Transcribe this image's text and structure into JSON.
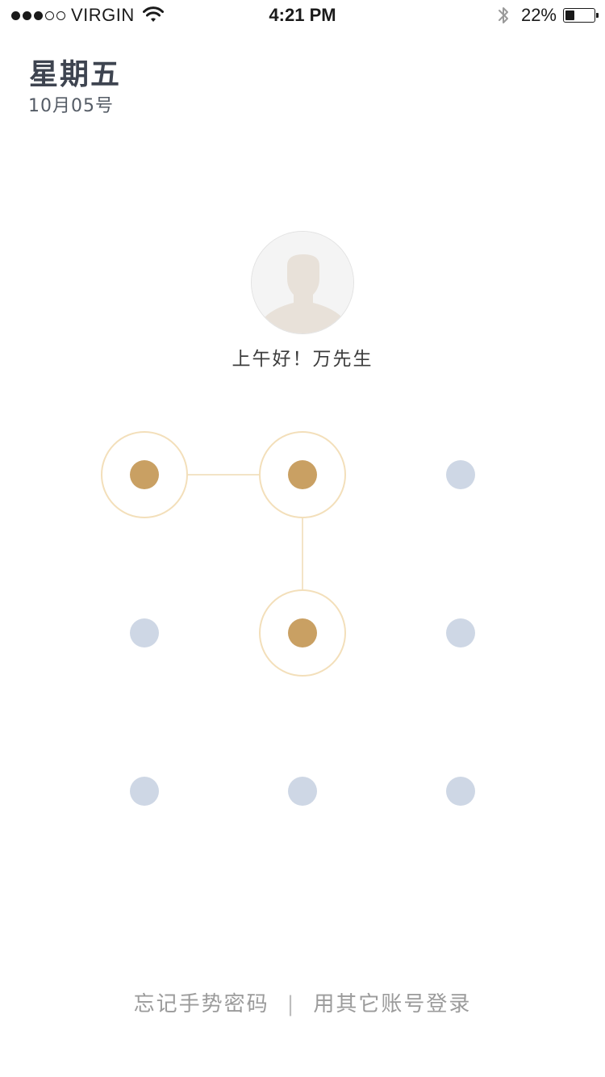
{
  "status_bar": {
    "signal_bars": [
      true,
      true,
      true,
      false,
      false
    ],
    "carrier": "VIRGIN",
    "wifi_icon": "wifi-icon",
    "time": "4:21 PM",
    "bluetooth_icon": "bluetooth-icon",
    "battery_percent_text": "22%",
    "battery_level": 0.22
  },
  "header": {
    "day_of_week": "星期五",
    "date": "10月05号"
  },
  "profile": {
    "avatar_icon": "user-silhouette-icon",
    "greeting": "上午好！万先生"
  },
  "gesture_lock": {
    "grid": [
      [
        "active",
        "active",
        "idle"
      ],
      [
        "idle",
        "active",
        "idle"
      ],
      [
        "idle",
        "idle",
        "idle"
      ]
    ],
    "path": [
      [
        0,
        0
      ],
      [
        0,
        1
      ],
      [
        1,
        1
      ]
    ],
    "colors": {
      "active_dot": "#c9a063",
      "active_ring": "#f3dfba",
      "idle_dot": "#ced7e5",
      "line": "#f3e4c7"
    }
  },
  "footer": {
    "forgot_label": "忘记手势密码",
    "separator": "|",
    "other_account_label": "用其它账号登录"
  }
}
